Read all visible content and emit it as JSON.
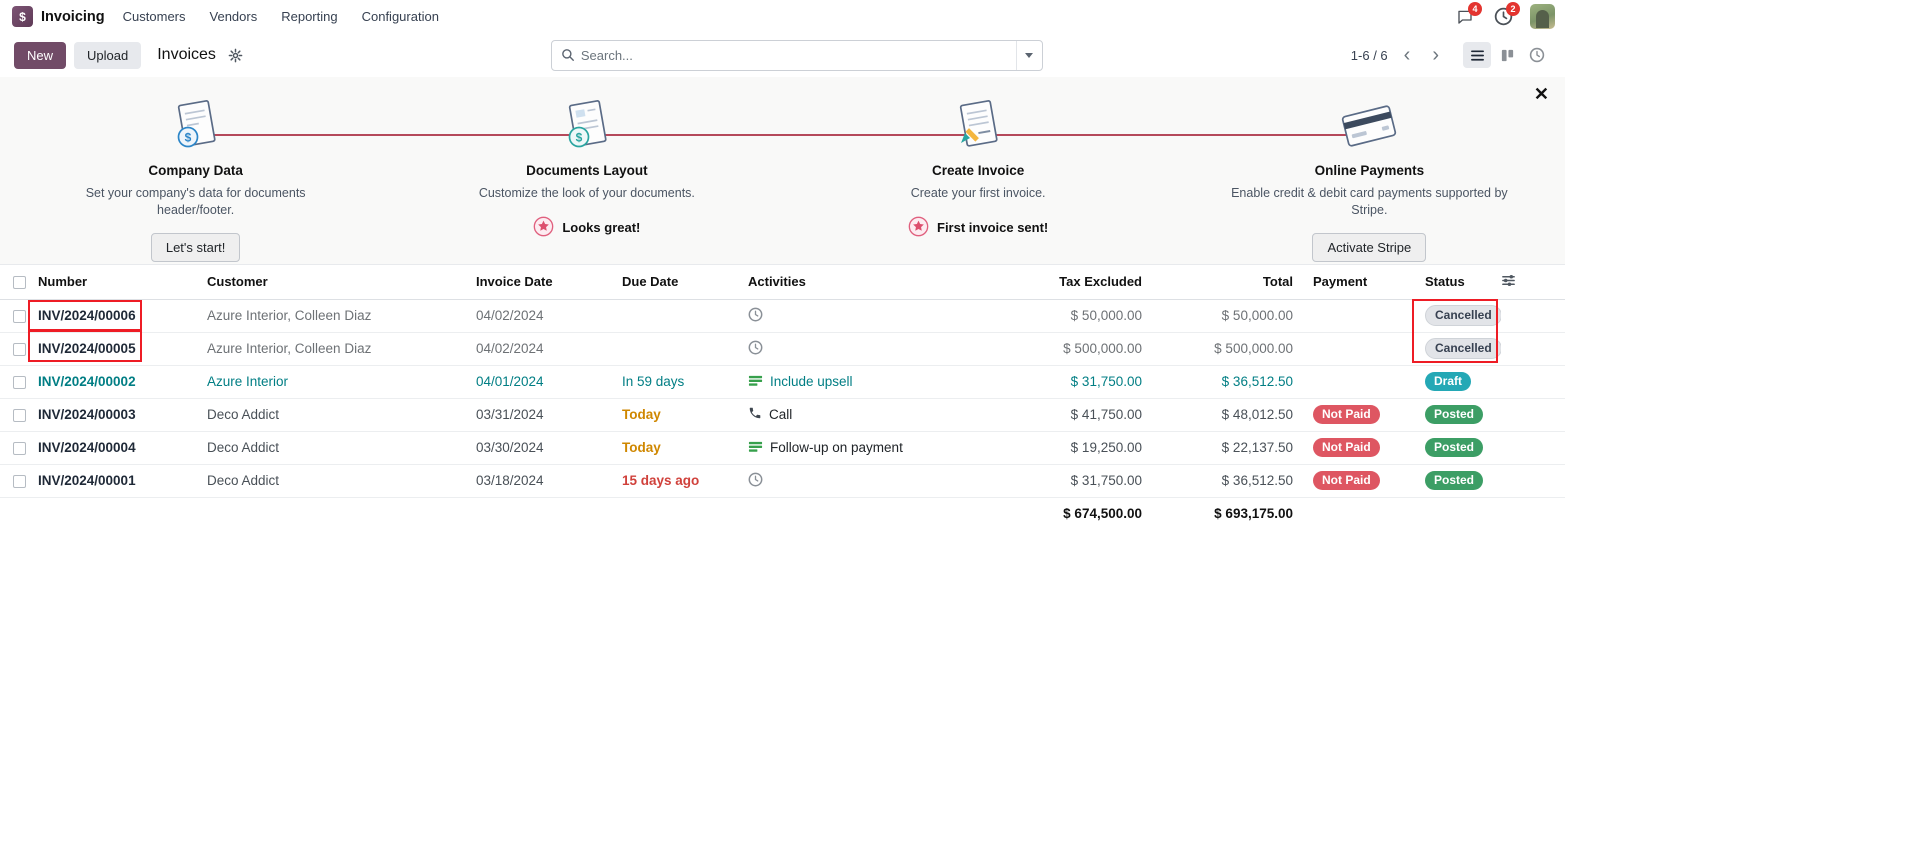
{
  "topbar": {
    "app_name": "Invoicing",
    "menus": [
      "Customers",
      "Vendors",
      "Reporting",
      "Configuration"
    ],
    "messages_badge": "4",
    "activities_badge": "2"
  },
  "control_panel": {
    "new_button": "New",
    "upload_button": "Upload",
    "breadcrumb": "Invoices",
    "search": {
      "placeholder": "Search..."
    },
    "pager": {
      "range": "1-6 / 6"
    }
  },
  "onboarding": {
    "steps": [
      {
        "title": "Company Data",
        "description": "Set your company's data for documents header/footer.",
        "action_label": "Let's start!",
        "kind": "button",
        "icon": "company-document-icon"
      },
      {
        "title": "Documents Layout",
        "description": "Customize the look of your documents.",
        "action_label": "Looks great!",
        "kind": "done",
        "icon": "layout-document-icon"
      },
      {
        "title": "Create Invoice",
        "description": "Create your first invoice.",
        "action_label": "First invoice sent!",
        "kind": "done",
        "icon": "invoice-document-icon"
      },
      {
        "title": "Online Payments",
        "description": "Enable credit & debit card payments supported by Stripe.",
        "action_label": "Activate Stripe",
        "kind": "button",
        "icon": "credit-card-icon"
      }
    ]
  },
  "table": {
    "headers": {
      "number": "Number",
      "customer": "Customer",
      "invoice_date": "Invoice Date",
      "due_date": "Due Date",
      "activities": "Activities",
      "tax_excluded": "Tax Excluded",
      "total": "Total",
      "payment": "Payment",
      "status": "Status"
    },
    "rows": [
      {
        "number": "INV/2024/00006",
        "customer": "Azure Interior, Colleen Diaz",
        "invoice_date": "04/02/2024",
        "due_date": "",
        "activity_label": "",
        "tax_excluded": "$ 50,000.00",
        "total": "$ 50,000.00",
        "payment": "",
        "status": "Cancelled"
      },
      {
        "number": "INV/2024/00005",
        "customer": "Azure Interior, Colleen Diaz",
        "invoice_date": "04/02/2024",
        "due_date": "",
        "activity_label": "",
        "tax_excluded": "$ 500,000.00",
        "total": "$ 500,000.00",
        "payment": "",
        "status": "Cancelled"
      },
      {
        "number": "INV/2024/00002",
        "customer": "Azure Interior",
        "invoice_date": "04/01/2024",
        "due_date": "In 59 days",
        "activity_label": "Include upsell",
        "tax_excluded": "$ 31,750.00",
        "total": "$ 36,512.50",
        "payment": "",
        "status": "Draft"
      },
      {
        "number": "INV/2024/00003",
        "customer": "Deco Addict",
        "invoice_date": "03/31/2024",
        "due_date": "Today",
        "activity_label": "Call",
        "tax_excluded": "$ 41,750.00",
        "total": "$ 48,012.50",
        "payment": "Not Paid",
        "status": "Posted"
      },
      {
        "number": "INV/2024/00004",
        "customer": "Deco Addict",
        "invoice_date": "03/30/2024",
        "due_date": "Today",
        "activity_label": "Follow-up on payment",
        "tax_excluded": "$ 19,250.00",
        "total": "$ 22,137.50",
        "payment": "Not Paid",
        "status": "Posted"
      },
      {
        "number": "INV/2024/00001",
        "customer": "Deco Addict",
        "invoice_date": "03/18/2024",
        "due_date": "15 days ago",
        "activity_label": "",
        "tax_excluded": "$ 31,750.00",
        "total": "$ 36,512.50",
        "payment": "Not Paid",
        "status": "Posted"
      }
    ],
    "totals": {
      "tax_excluded": "$ 674,500.00",
      "total": "$ 693,175.00"
    }
  },
  "colors": {
    "brand_purple": "#714B67",
    "draft_teal": "#017E84",
    "posted_green": "#3c9e65",
    "not_paid_red": "#de5662",
    "cancelled_gray": "#e2e4e8",
    "warning_orange": "#cf8700",
    "overdue_red": "#d0413b",
    "annotation_red": "#ee1c25",
    "onboarding_line": "#b5495b"
  }
}
